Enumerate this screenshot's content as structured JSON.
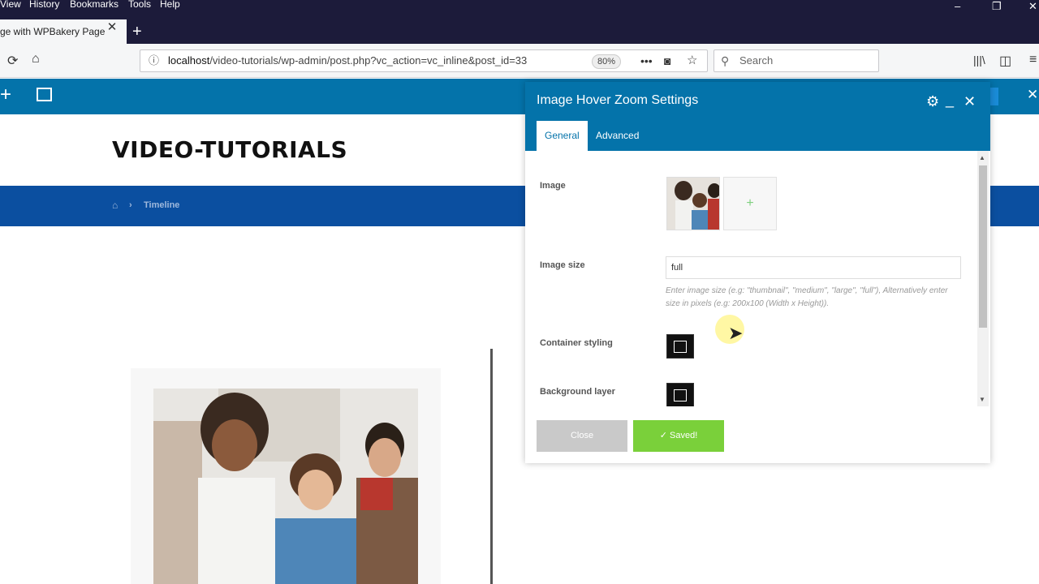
{
  "browser": {
    "menu": [
      {
        "label": "View"
      },
      {
        "label": "History"
      },
      {
        "label": "Bookmarks"
      },
      {
        "label": "Tools"
      },
      {
        "label": "Help"
      }
    ],
    "tab_title": "ge with WPBakery Page",
    "url_host": "localhost",
    "url_path": "/video-tutorials/wp-admin/post.php?vc_action=vc_inline&post_id=33",
    "zoom": "80%",
    "search_placeholder": "Search"
  },
  "page": {
    "site_title": "VIDEO-TUTORIALS",
    "breadcrumb": [
      "Timeline"
    ]
  },
  "modal": {
    "title": "Image Hover Zoom Settings",
    "tabs": [
      {
        "label": "General"
      },
      {
        "label": "Advanced"
      }
    ],
    "fields": {
      "image_label": "Image",
      "image_size_label": "Image size",
      "image_size_value": "full",
      "image_size_help": "Enter image size (e.g: \"thumbnail\", \"medium\", \"large\", \"full\"), Alternatively enter size in pixels (e.g: 200x100 (Width x Height)).",
      "container_styling_label": "Container styling",
      "background_layer_label": "Background layer"
    },
    "close_label": "Close",
    "saved_label": "✓ Saved!"
  }
}
